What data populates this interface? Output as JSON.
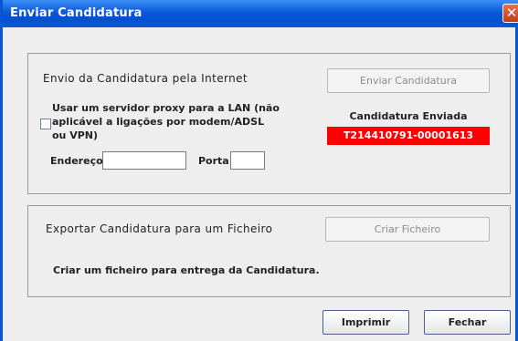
{
  "window": {
    "title": "Enviar Candidatura",
    "close_glyph": "✕"
  },
  "internet_panel": {
    "heading": "Envio da Candidatura pela Internet",
    "send_button": "Enviar Candidatura",
    "proxy_checkbox_checked": false,
    "proxy_label": "Usar um servidor proxy para a LAN (não aplicável a ligações por modem/ADSL ou VPN)",
    "address_label": "Endereço",
    "address_value": "",
    "port_label": "Porta",
    "port_value": "",
    "status_title": "Candidatura Enviada",
    "status_value": "T214410791-00001613",
    "status_color": "#ff0000"
  },
  "export_panel": {
    "heading": "Exportar Candidatura para um Ficheiro",
    "create_button": "Criar Ficheiro",
    "description": "Criar um ficheiro para entrega da Candidatura."
  },
  "footer": {
    "print_button": "Imprimir",
    "close_button": "Fechar"
  },
  "colors": {
    "titlebar": "#0a5ad7",
    "window_bg": "#eeeeee"
  }
}
